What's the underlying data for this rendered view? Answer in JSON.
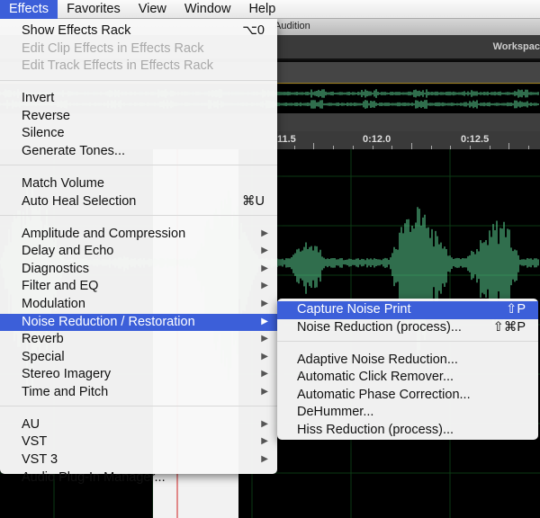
{
  "menubar": [
    "Effects",
    "Favorites",
    "View",
    "Window",
    "Help"
  ],
  "app": {
    "title": "Audition",
    "workspace": "Workspac",
    "ruler": [
      "11.5",
      "0:12.0",
      "0:12.5"
    ]
  },
  "effects_menu": [
    {
      "label": "Show Effects Rack",
      "shortcut": "⌥0"
    },
    {
      "label": "Edit Clip Effects in Effects Rack",
      "disabled": true
    },
    {
      "label": "Edit Track Effects in Effects Rack",
      "disabled": true
    },
    {
      "sep": true
    },
    {
      "label": "Invert"
    },
    {
      "label": "Reverse"
    },
    {
      "label": "Silence"
    },
    {
      "label": "Generate Tones..."
    },
    {
      "sep": true
    },
    {
      "label": "Match Volume"
    },
    {
      "label": "Auto Heal Selection",
      "shortcut": "⌘U"
    },
    {
      "sep": true
    },
    {
      "label": "Amplitude and Compression",
      "submenu": true
    },
    {
      "label": "Delay and Echo",
      "submenu": true
    },
    {
      "label": "Diagnostics",
      "submenu": true
    },
    {
      "label": "Filter and EQ",
      "submenu": true
    },
    {
      "label": "Modulation",
      "submenu": true
    },
    {
      "label": "Noise Reduction / Restoration",
      "submenu": true,
      "highlighted": true
    },
    {
      "label": "Reverb",
      "submenu": true
    },
    {
      "label": "Special",
      "submenu": true
    },
    {
      "label": "Stereo Imagery",
      "submenu": true
    },
    {
      "label": "Time and Pitch",
      "submenu": true
    },
    {
      "sep": true
    },
    {
      "label": "AU",
      "submenu": true
    },
    {
      "label": "VST",
      "submenu": true
    },
    {
      "label": "VST 3",
      "submenu": true
    },
    {
      "label": "Audio Plug-In Manager..."
    }
  ],
  "submenu": [
    {
      "label": "Capture Noise Print",
      "shortcut": "⇧P",
      "highlighted": true
    },
    {
      "label": "Noise Reduction (process)...",
      "shortcut": "⇧⌘P"
    },
    {
      "sep": true
    },
    {
      "label": "Adaptive Noise Reduction..."
    },
    {
      "label": "Automatic Click Remover..."
    },
    {
      "label": "Automatic Phase Correction..."
    },
    {
      "label": "DeHummer..."
    },
    {
      "label": "Hiss Reduction (process)..."
    }
  ],
  "colors": {
    "highlight": "#3c5fd9",
    "waveform": "#5fdc9a"
  }
}
